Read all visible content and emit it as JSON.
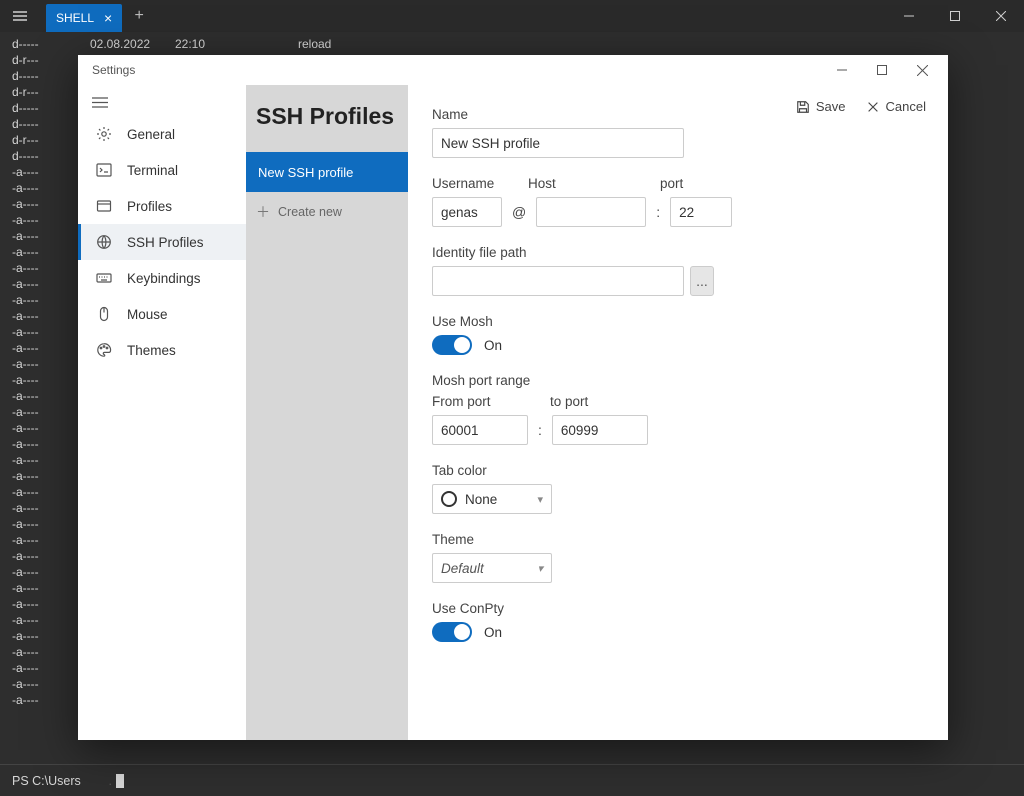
{
  "titlebar": {
    "tab_label": "SHELL"
  },
  "terminal": {
    "prompt": "PS C:\\Users",
    "line_listing": "d-----\nd-r---\nd-----\nd-r---\nd-----\nd-----\nd-r---\nd-----\n-a----\n-a----\n-a----\n-a----\n-a----\n-a----\n-a----\n-a----\n-a----\n-a----\n-a----\n-a----\n-a----\n-a----\n-a----\n-a----\n-a----\n-a----\n-a----\n-a----\n-a----\n-a----\n-a----\n-a----\n-a----\n-a----\n-a----\n-a----\n-a----\n-a----\n-a----\n-a----\n-a----\n-a----",
    "date": "02.08.2022",
    "time": "22:10",
    "extra": "reload"
  },
  "settings": {
    "window_title": "Settings",
    "heading": "SSH Profiles",
    "save_label": "Save",
    "cancel_label": "Cancel"
  },
  "sidebar": {
    "items": [
      {
        "label": "General"
      },
      {
        "label": "Terminal"
      },
      {
        "label": "Profiles"
      },
      {
        "label": "SSH Profiles"
      },
      {
        "label": "Keybindings"
      },
      {
        "label": "Mouse"
      },
      {
        "label": "Themes"
      }
    ]
  },
  "midcol": {
    "profile_label": "New SSH profile",
    "create_label": "Create new"
  },
  "form": {
    "name_label": "Name",
    "name_value": "New SSH profile",
    "username_label": "Username",
    "host_label": "Host",
    "port_label": "port",
    "username_value": "genas",
    "host_value": "",
    "port_value": "22",
    "at": "@",
    "colon": ":",
    "identity_label": "Identity file path",
    "identity_value": "",
    "browse_glyph": "...",
    "use_mosh_label": "Use Mosh",
    "on_label": "On",
    "mosh_range_label": "Mosh port range",
    "from_port_label": "From port",
    "to_port_label": "to port",
    "from_port_value": "60001",
    "to_port_value": "60999",
    "tab_color_label": "Tab color",
    "tab_color_value": "None",
    "theme_label": "Theme",
    "theme_value": "Default",
    "conpty_label": "Use ConPty"
  }
}
